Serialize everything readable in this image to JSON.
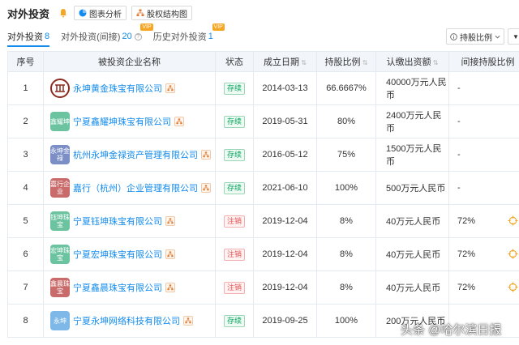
{
  "header": {
    "title": "对外投资",
    "tool_buttons": [
      {
        "label": "图表分析"
      },
      {
        "label": "股权结构图"
      }
    ]
  },
  "tabs": [
    {
      "label": "对外投资",
      "count": "8",
      "active": true
    },
    {
      "label": "对外投资(间接)",
      "count": "20",
      "vip": "VIP"
    },
    {
      "label": "历史对外投资",
      "count": "1",
      "vip": "VIP"
    }
  ],
  "sort_button": {
    "label": "持股比例"
  },
  "table": {
    "columns": [
      "序号",
      "被投资企业名称",
      "状态",
      "成立日期",
      "持股比例",
      "认缴出资额",
      "间接持股比例"
    ],
    "rows": [
      {
        "index": "1",
        "logo_text": "",
        "logo_color": "#8b2b1f",
        "name": "永坤黄金珠宝有限公司",
        "status": "存续",
        "date": "2014-03-13",
        "ratio": "66.6667%",
        "capital": "40000万元人民币",
        "indirect": "-"
      },
      {
        "index": "2",
        "logo_text": "鑫耀坤",
        "logo_color": "#6cc3a0",
        "name": "宁夏鑫耀坤珠宝有限公司",
        "status": "存续",
        "date": "2019-05-31",
        "ratio": "80%",
        "capital": "2400万元人民币",
        "indirect": "-"
      },
      {
        "index": "3",
        "logo_text": "永坤金禄",
        "logo_color": "#7b8fc6",
        "name": "杭州永坤金禄资产管理有限公司",
        "status": "存续",
        "date": "2016-05-12",
        "ratio": "75%",
        "capital": "1500万元人民币",
        "indirect": "-"
      },
      {
        "index": "4",
        "logo_text": "嘉行企业",
        "logo_color": "#c96b6b",
        "name": "嘉行（杭州）企业管理有限公司",
        "status": "存续",
        "date": "2021-06-10",
        "ratio": "100%",
        "capital": "500万元人民币",
        "indirect": "-"
      },
      {
        "index": "5",
        "logo_text": "钰坤珠宝",
        "logo_color": "#6cc3a0",
        "name": "宁夏钰坤珠宝有限公司",
        "status": "注销",
        "date": "2019-12-04",
        "ratio": "8%",
        "capital": "40万元人民币",
        "indirect": "72%"
      },
      {
        "index": "6",
        "logo_text": "宏坤珠宝",
        "logo_color": "#6cc3a0",
        "name": "宁夏宏坤珠宝有限公司",
        "status": "注销",
        "date": "2019-12-04",
        "ratio": "8%",
        "capital": "40万元人民币",
        "indirect": "72%"
      },
      {
        "index": "7",
        "logo_text": "鑫晨珠宝",
        "logo_color": "#c96b6b",
        "name": "宁夏鑫晨珠宝有限公司",
        "status": "注销",
        "date": "2019-12-04",
        "ratio": "8%",
        "capital": "40万元人民币",
        "indirect": "72%"
      },
      {
        "index": "8",
        "logo_text": "永坤",
        "logo_color": "#7db8e8",
        "name": "宁夏永坤网络科技有限公司",
        "status": "存续",
        "date": "2019-09-25",
        "ratio": "100%",
        "capital": "200万元人民币",
        "indirect": ""
      }
    ]
  },
  "watermark": "头条 @哈尔滨日报",
  "colors": {
    "accent": "#128bed",
    "active_status": "#00a45a",
    "cancelled_status": "#e64f4f"
  }
}
